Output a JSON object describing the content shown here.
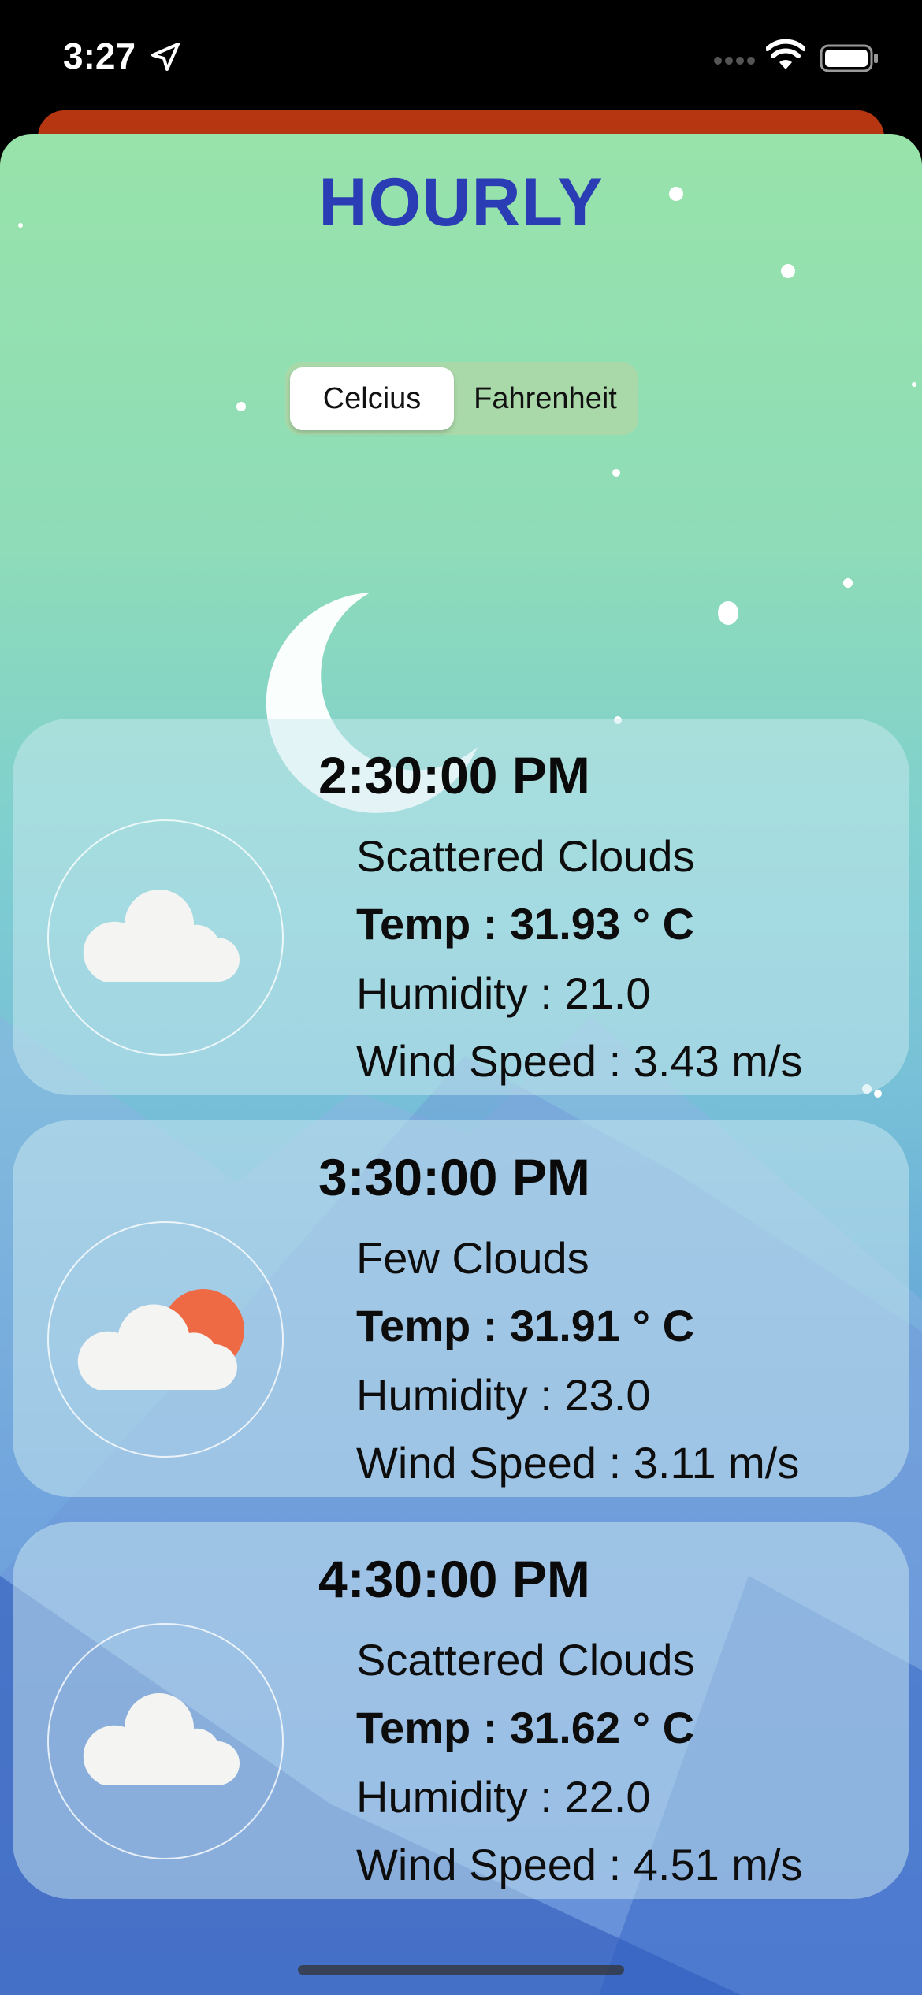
{
  "status_bar": {
    "time": "3:27"
  },
  "header": {
    "title": "HOURLY"
  },
  "unit_toggle": {
    "options": [
      "Celcius",
      "Fahrenheit"
    ],
    "selected": "Celcius"
  },
  "forecasts": [
    {
      "time": "2:30:00 PM",
      "description": "Scattered Clouds",
      "temp": "Temp : 31.93 ° C",
      "humidity": "Humidity : 21.0",
      "wind": "Wind Speed : 3.43 m/s",
      "icon": "cloud-icon"
    },
    {
      "time": "3:30:00 PM",
      "description": "Few Clouds",
      "temp": "Temp : 31.91 ° C",
      "humidity": "Humidity : 23.0",
      "wind": "Wind Speed : 3.11 m/s",
      "icon": "cloud-sun-icon"
    },
    {
      "time": "4:30:00 PM",
      "description": "Scattered Clouds",
      "temp": "Temp : 31.62 ° C",
      "humidity": "Humidity : 22.0",
      "wind": "Wind Speed : 4.51 m/s",
      "icon": "cloud-icon"
    }
  ],
  "colors": {
    "title": "#2a3db5",
    "sheet_top": "#98e3aa",
    "sheet_bottom": "#3f6fd0",
    "sun": "#ee6a45",
    "back_sheet": "#b73612"
  }
}
